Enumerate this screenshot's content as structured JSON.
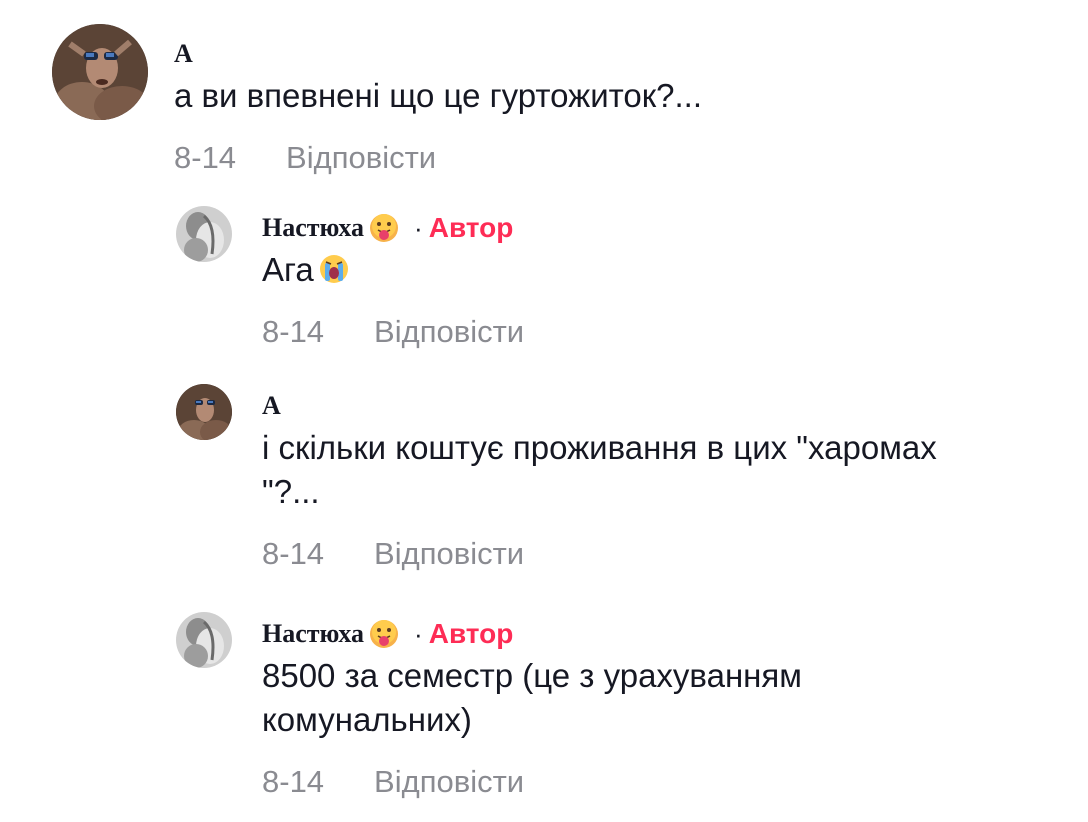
{
  "comments": [
    {
      "username": "A",
      "text": "а ви впевнені що це гуртожиток?...",
      "date": "8-14",
      "reply_label": "Відповісти",
      "avatar_icon": "user-avatar-photo"
    },
    {
      "username": "Настюха",
      "name_emoji": "face-with-tongue-emoji",
      "author_badge": "Автор",
      "separator": "·",
      "text": "Ага",
      "text_emoji": "loudly-crying-face-emoji",
      "date": "8-14",
      "reply_label": "Відповісти",
      "avatar_icon": "user-avatar-photo"
    },
    {
      "username": "A",
      "text": "і скільки коштує проживання в цих \"харомах\n\"?...",
      "date": "8-14",
      "reply_label": "Відповісти",
      "avatar_icon": "user-avatar-photo"
    },
    {
      "username": "Настюха",
      "name_emoji": "face-with-tongue-emoji",
      "author_badge": "Автор",
      "separator": "·",
      "text": "8500 за семестр (це з урахуванням\nкомунальних)",
      "date": "8-14",
      "reply_label": "Відповісти",
      "avatar_icon": "user-avatar-photo"
    }
  ],
  "colors": {
    "text": "#161823",
    "muted": "#8a8b91",
    "author_badge": "#fe2c55"
  }
}
